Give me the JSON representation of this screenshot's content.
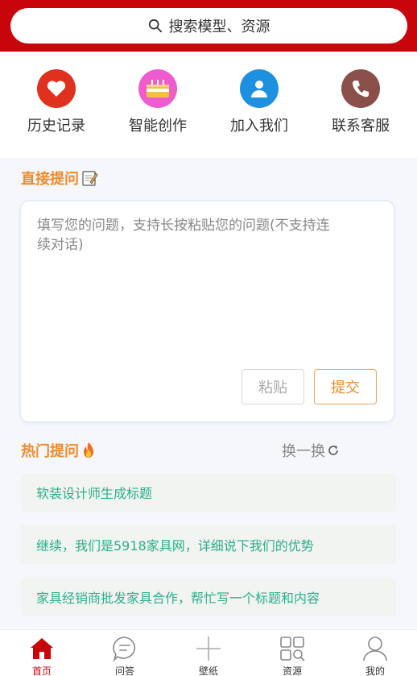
{
  "search": {
    "placeholder": "搜索模型、资源"
  },
  "quick_links": [
    {
      "label": "历史记录",
      "icon": "heart-icon",
      "color": "#e0301e"
    },
    {
      "label": "智能创作",
      "icon": "cake-icon",
      "color": "#f05bd0"
    },
    {
      "label": "加入我们",
      "icon": "user-icon",
      "color": "#1e90e0"
    },
    {
      "label": "联系客服",
      "icon": "phone-icon",
      "color": "#8b4f4a"
    }
  ],
  "ask": {
    "title": "直接提问",
    "placeholder": "填写您的问题，支持长按粘贴您的问题(不支持连续对话)",
    "paste_label": "粘贴",
    "submit_label": "提交"
  },
  "hot": {
    "title": "热门提问",
    "refresh_label": "换一换",
    "items": [
      "软装设计师生成标题",
      "继续，我们是5918家具网，详细说下我们的优势",
      "家具经销商批发家具合作，帮忙写一个标题和内容"
    ]
  },
  "tabs": [
    {
      "label": "首页",
      "icon": "home-icon",
      "active": true
    },
    {
      "label": "问答",
      "icon": "chat-icon"
    },
    {
      "label": "壁纸",
      "icon": "plus-icon"
    },
    {
      "label": "资源",
      "icon": "grid-icon"
    },
    {
      "label": "我的",
      "icon": "profile-icon"
    }
  ],
  "colors": {
    "brand": "#c8050a",
    "accent": "#f08a2c",
    "link": "#2bb08a"
  }
}
